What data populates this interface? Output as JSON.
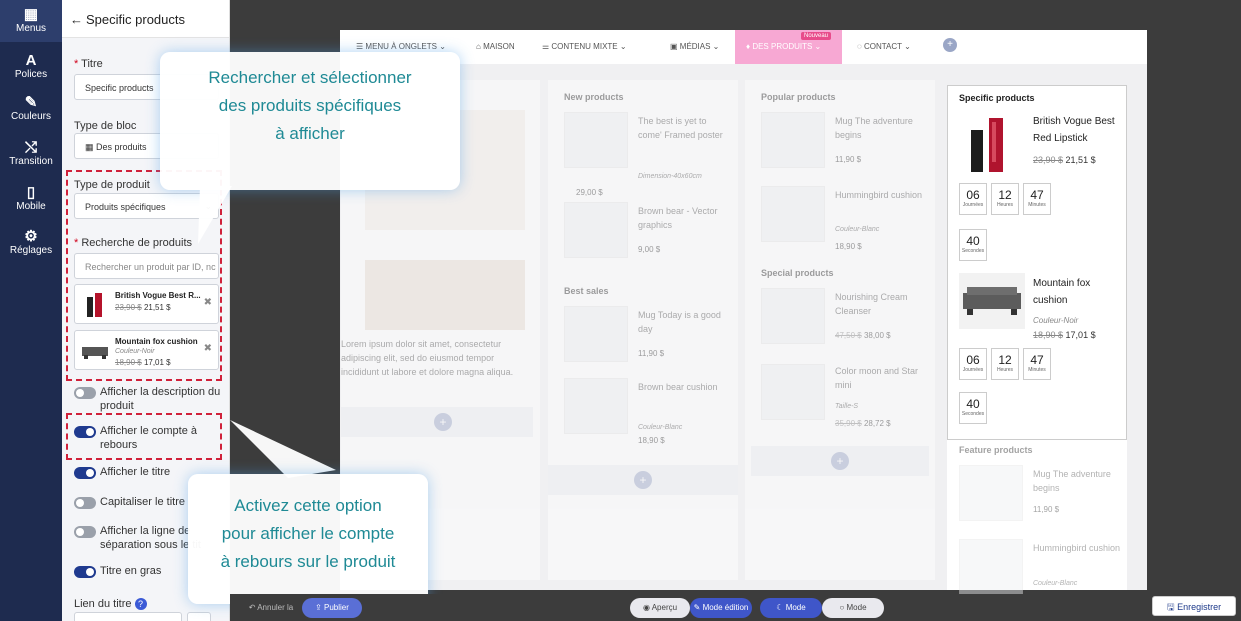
{
  "rail": {
    "items": [
      {
        "icon": "grid-icon",
        "glyph": "▦",
        "label": "Menus"
      },
      {
        "icon": "font-icon",
        "glyph": "A",
        "label": "Polices"
      },
      {
        "icon": "brush-icon",
        "glyph": "✎",
        "label": "Couleurs"
      },
      {
        "icon": "shuffle-icon",
        "glyph": "⤭",
        "label": "Transition"
      },
      {
        "icon": "mobile-icon",
        "glyph": "▯",
        "label": "Mobile"
      },
      {
        "icon": "gear-icon",
        "glyph": "⚙",
        "label": "Réglages"
      }
    ]
  },
  "panel": {
    "back_glyph": "←",
    "title": "Specific products",
    "titre_label": "Titre",
    "titre_value": "Specific products",
    "type_bloc_label": "Type de bloc",
    "type_bloc_value": "Des produits",
    "type_produit_label": "Type de produit",
    "type_produit_value": "Produits spécifiques",
    "recherche_label": "Recherche de produits",
    "recherche_placeholder": "Rechercher un produit par ID, nc",
    "selected": [
      {
        "name": "British Vogue Best R...",
        "old_price": "23,90 $",
        "price": "21,51 $"
      },
      {
        "name": "Mountain fox cushion",
        "variant": "Couleur-Noir",
        "old_price": "18,90 $",
        "price": "17,01 $"
      }
    ],
    "remove_glyph": "✖",
    "toggles": [
      {
        "label": "Afficher la description du produit",
        "on": false
      },
      {
        "label": "Afficher le compte à rebours",
        "on": true
      },
      {
        "label": "Afficher le titre",
        "on": true
      },
      {
        "label": "Capitaliser le titre",
        "on": false
      },
      {
        "label": "Afficher la ligne de séparation sous le tit",
        "on": false
      },
      {
        "label": "Titre en gras",
        "on": true
      }
    ],
    "lien_label": "Lien du titre",
    "help_glyph": "?"
  },
  "menubar": {
    "items": [
      "Menu à onglets",
      "Maison",
      "Contenu mixte",
      "Médias",
      "Des produits",
      "Contact"
    ],
    "badge": "Nouveau",
    "plus_glyph": "+"
  },
  "canvas": {
    "lorem": "Lorem ipsum dolor sit amet, consectetur adipiscing elit, sed do eiusmod tempor incididunt ut labore et dolore magna aliqua.",
    "col2": {
      "title1": "New products",
      "items1": [
        {
          "name": "The best is yet to come' Framed poster",
          "variant": "Dimension-40x60cm",
          "price": "29,00 $"
        },
        {
          "name": "Brown bear - Vector graphics",
          "price": "9,00 $"
        }
      ],
      "title2": "Best sales",
      "items2": [
        {
          "name": "Mug Today is a good day",
          "price": "11,90 $"
        },
        {
          "name": "Brown bear cushion",
          "variant": "Couleur-Blanc",
          "price": "18,90 $"
        }
      ]
    },
    "col3": {
      "title1": "Popular products",
      "items1": [
        {
          "name": "Mug The adventure begins",
          "price": "11,90 $"
        },
        {
          "name": "Hummingbird cushion",
          "variant": "Couleur-Blanc",
          "price": "18,90 $"
        }
      ],
      "title2": "Special products",
      "items2": [
        {
          "name": "Nourishing Cream Cleanser",
          "old_price": "47,50 $",
          "price": "38,00 $"
        },
        {
          "name": "Color moon and Star mini",
          "variant": "Taille-S",
          "old_price": "35,90 $",
          "price": "28,72 $"
        }
      ]
    },
    "col4": {
      "title": "Specific products",
      "items": [
        {
          "name": "British Vogue Best Red Lipstick",
          "old_price": "23,90 $",
          "price": "21,51 $",
          "countdown": [
            {
              "n": "06",
              "u": "Journées"
            },
            {
              "n": "12",
              "u": "Heures"
            },
            {
              "n": "47",
              "u": "Minutes"
            },
            {
              "n": "40",
              "u": "Secondes"
            }
          ]
        },
        {
          "name": "Mountain fox cushion",
          "variant": "Couleur-Noir",
          "old_price": "18,90 $",
          "price": "17,01 $",
          "countdown": [
            {
              "n": "06",
              "u": "Journées"
            },
            {
              "n": "12",
              "u": "Heures"
            },
            {
              "n": "47",
              "u": "Minutes"
            },
            {
              "n": "40",
              "u": "Secondes"
            }
          ]
        }
      ],
      "feature_title": "Feature products",
      "feature_items": [
        {
          "name": "Mug The adventure begins",
          "price": "11,90 $"
        },
        {
          "name": "Hummingbird cushion",
          "variant": "Couleur-Blanc"
        }
      ]
    }
  },
  "callouts": {
    "top": [
      "Rechercher et sélectionner",
      "des produits spécifiques",
      "à afficher"
    ],
    "bottom": [
      "Activez cette option",
      "pour afficher le compte",
      "à rebours sur le produit"
    ]
  },
  "bottombar": {
    "undo": "Annuler la",
    "publish": "Publier",
    "apercu": "Aperçu",
    "edit": "Mode édition",
    "mode_dark": "Mode",
    "mode_light": "Mode",
    "save": "Enregistrer"
  },
  "colors": {
    "rail": "#1e2b4f",
    "accent": "#1f3a8f",
    "dashed": "#d0213a",
    "callout_text": "#1f8a95",
    "menu_active": "#f7a8d3"
  }
}
